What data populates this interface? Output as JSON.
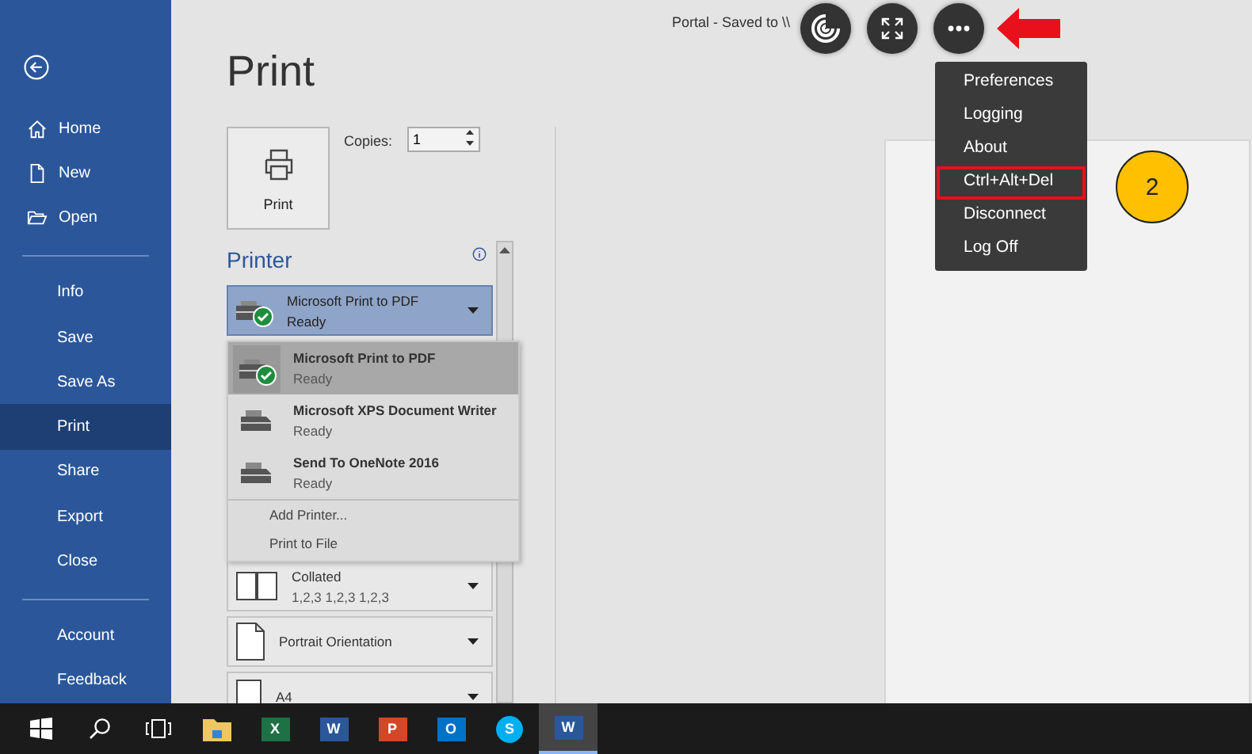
{
  "window": {
    "title": "Portal  -  Saved to \\\\"
  },
  "sidebar": {
    "groups": [
      {
        "items": [
          {
            "label": "Home",
            "kind": "home",
            "selected": false
          },
          {
            "label": "New",
            "kind": "new",
            "selected": false
          },
          {
            "label": "Open",
            "kind": "open",
            "selected": false
          }
        ]
      },
      {
        "items": [
          {
            "label": "Info",
            "kind": "plain",
            "selected": false
          },
          {
            "label": "Save",
            "kind": "plain",
            "selected": false
          },
          {
            "label": "Save As",
            "kind": "plain",
            "selected": false
          },
          {
            "label": "Print",
            "kind": "plain",
            "selected": true
          },
          {
            "label": "Share",
            "kind": "plain",
            "selected": false
          },
          {
            "label": "Export",
            "kind": "plain",
            "selected": false
          },
          {
            "label": "Close",
            "kind": "plain",
            "selected": false
          }
        ]
      },
      {
        "items": [
          {
            "label": "Account",
            "kind": "plain",
            "selected": false
          },
          {
            "label": "Feedback",
            "kind": "plain",
            "selected": false
          }
        ]
      }
    ]
  },
  "page_title": "Print",
  "print_button": {
    "label": "Print"
  },
  "copies": {
    "label": "Copies:",
    "value": "1"
  },
  "printer": {
    "heading": "Printer",
    "current": {
      "name": "Microsoft Print to PDF",
      "status": "Ready"
    },
    "options": [
      {
        "name": "Microsoft Print to PDF",
        "status": "Ready",
        "kind": "default",
        "selected": true
      },
      {
        "name": "Microsoft XPS Document Writer",
        "status": "Ready",
        "kind": "plain",
        "selected": false
      },
      {
        "name": "Send To OneNote 2016",
        "status": "Ready",
        "kind": "plain",
        "selected": false
      }
    ],
    "actions": [
      "Add Printer...",
      "Print to File"
    ]
  },
  "settings": [
    {
      "kind": "collated",
      "title": "Collated",
      "subtitle": "1,2,3   1,2,3   1,2,3"
    },
    {
      "kind": "orientation",
      "title": "Portrait Orientation"
    },
    {
      "kind": "paper",
      "title": "A4"
    }
  ],
  "toolbar": [
    {
      "kind": "spiral"
    },
    {
      "kind": "fullscreen"
    },
    {
      "kind": "more"
    }
  ],
  "menu": [
    {
      "label": "Preferences",
      "highlighted": false
    },
    {
      "label": "Logging",
      "highlighted": false
    },
    {
      "label": "About",
      "highlighted": false
    },
    {
      "label": "Ctrl+Alt+Del",
      "highlighted": true
    },
    {
      "label": "Disconnect",
      "highlighted": false
    },
    {
      "label": "Log Off",
      "highlighted": false
    }
  ],
  "callout": {
    "label": "2"
  },
  "taskbar": [
    {
      "kind": "start",
      "active": false
    },
    {
      "kind": "search",
      "active": false
    },
    {
      "kind": "taskview",
      "active": false
    },
    {
      "kind": "folder",
      "active": false
    },
    {
      "kind": "app",
      "letter": "X",
      "color": "#1e7145",
      "active": false
    },
    {
      "kind": "app",
      "letter": "W",
      "color": "#2b579a",
      "active": false
    },
    {
      "kind": "app",
      "letter": "P",
      "color": "#d24726",
      "active": false
    },
    {
      "kind": "app",
      "letter": "O",
      "color": "#0072c6",
      "active": false
    },
    {
      "kind": "skype",
      "letter": "S",
      "color": "#00aff0",
      "active": false
    },
    {
      "kind": "app",
      "letter": "W",
      "color": "#2b579a",
      "active": true
    }
  ]
}
